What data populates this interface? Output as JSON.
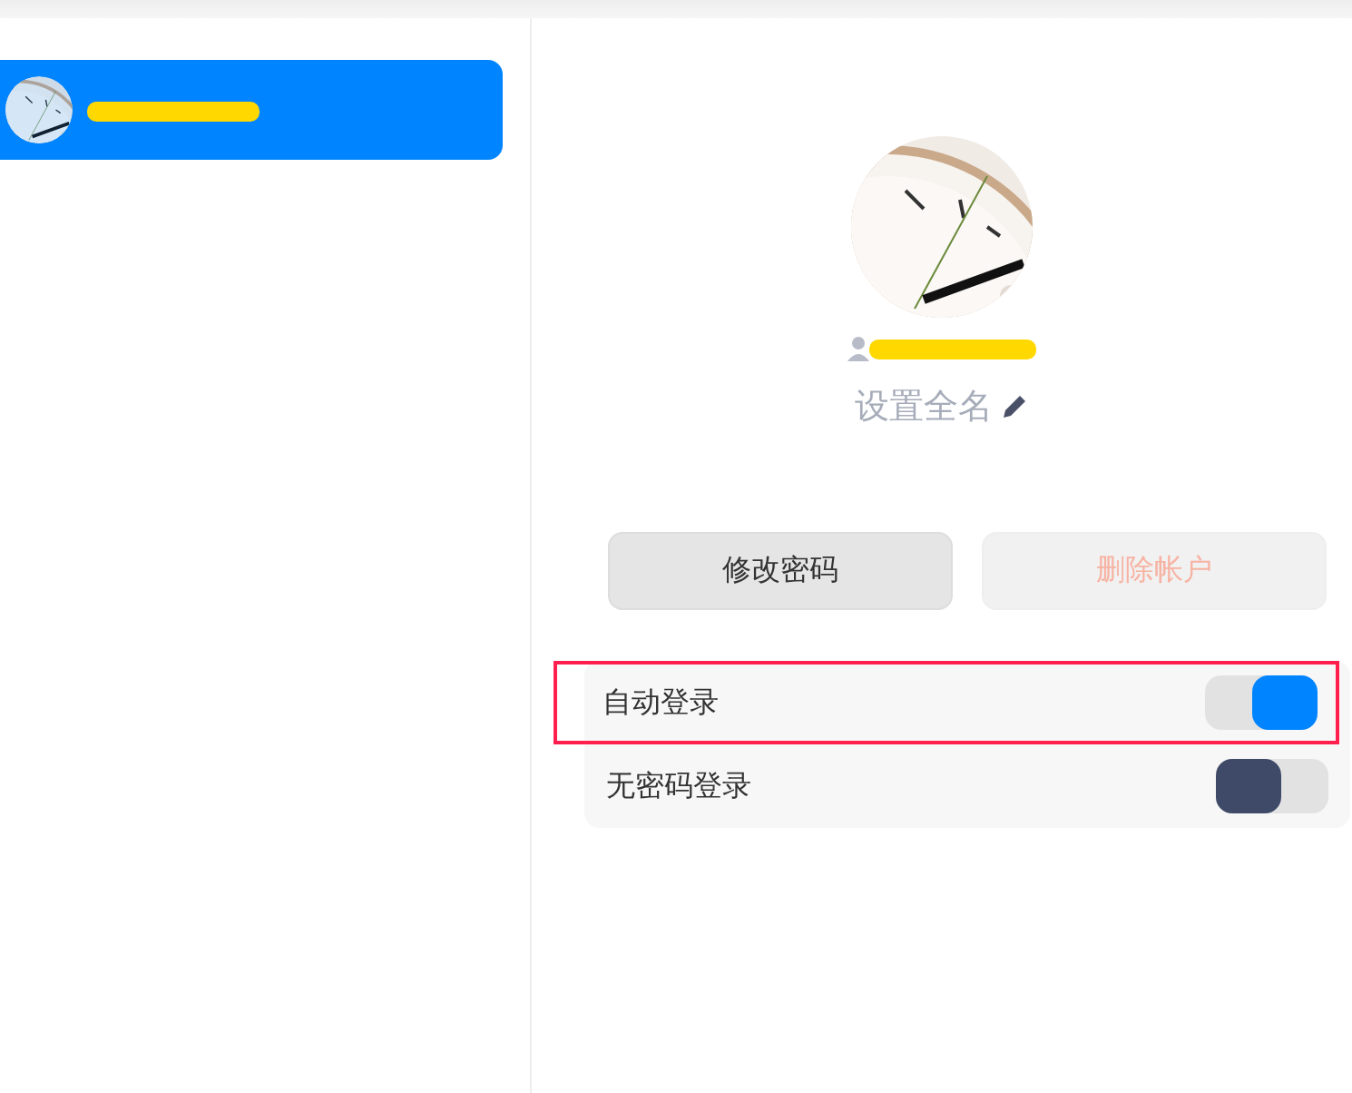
{
  "sidebar": {
    "accounts": [
      {
        "selected": true
      }
    ]
  },
  "profile": {
    "set_name_label": "设置全名"
  },
  "buttons": [
    {
      "label": "修改密码",
      "disabled": false
    },
    {
      "label": "删除帐户",
      "disabled": true
    }
  ],
  "settings": [
    {
      "label": "自动登录",
      "on": true,
      "highlighted": true
    },
    {
      "label": "无密码登录",
      "on": false,
      "highlighted": false
    }
  ]
}
